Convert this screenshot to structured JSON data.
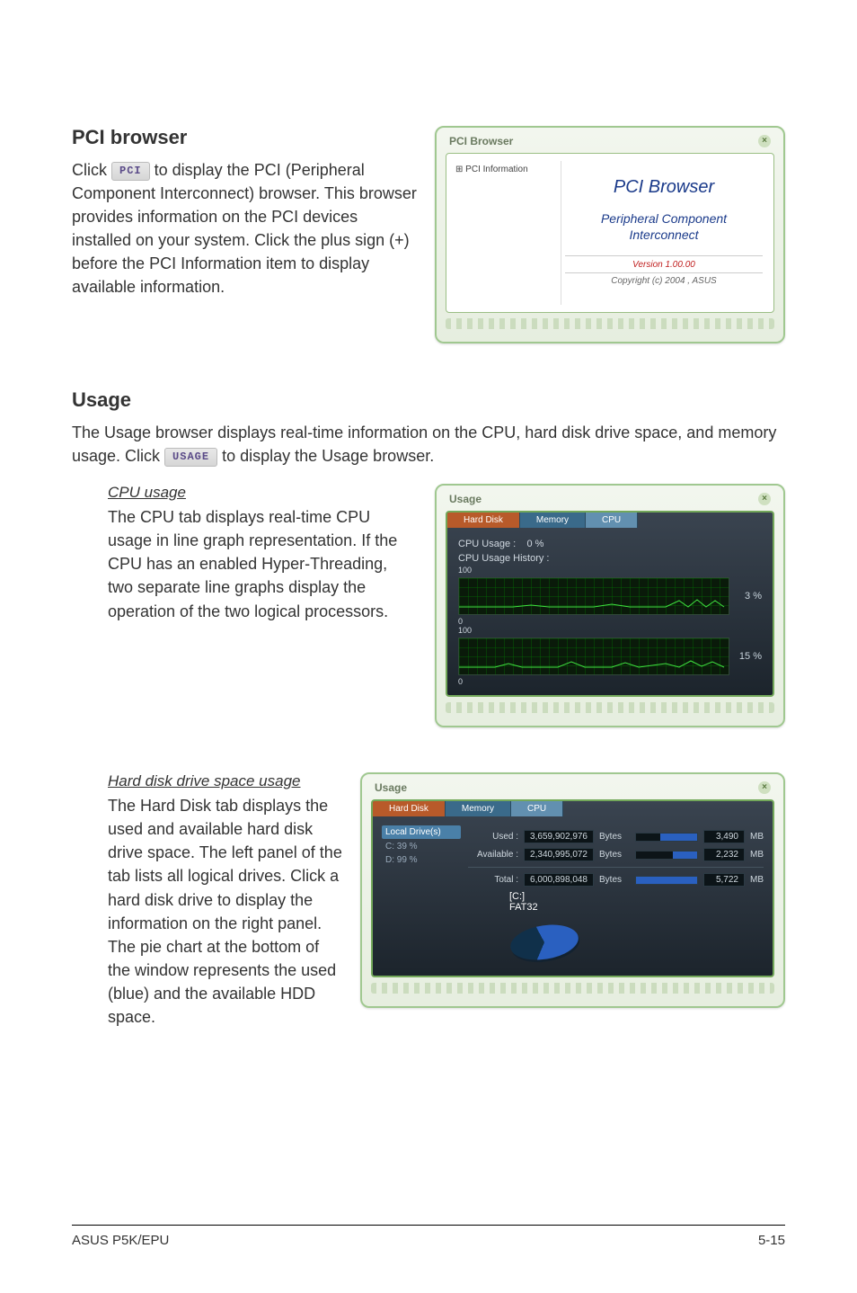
{
  "sections": {
    "pci": {
      "title": "PCI browser",
      "body_pre": "Click ",
      "btn": "PCI",
      "body_post": " to display the PCI (Peripheral Component Interconnect) browser. This browser provides information on the PCI devices installed on your system. Click the plus sign (+) before the PCI Information item to display available information."
    },
    "usage": {
      "title": "Usage",
      "intro_pre": "The Usage browser displays real-time information on the CPU, hard disk drive space, and memory usage. Click ",
      "btn": "USAGE",
      "intro_post": " to display the Usage browser.",
      "cpu": {
        "heading": "CPU usage",
        "body": "The CPU tab displays real-time CPU usage in line graph representation. If the CPU has an enabled Hyper-Threading, two separate line graphs display the operation of the two logical processors."
      },
      "hdd": {
        "heading": "Hard disk drive space usage",
        "body": "The Hard Disk tab displays the used and available hard disk drive space. The left panel of the tab lists all logical drives. Click a hard disk drive to display the information on the right panel. The pie chart at the bottom of the window represents the used (blue) and the available HDD space."
      }
    }
  },
  "pci_window": {
    "title": "PCI Browser",
    "tree_root": "PCI Information",
    "heading": "PCI Browser",
    "sub": "Peripheral Component Interconnect",
    "version": "Version 1.00.00",
    "copyright": "Copyright (c) 2004 , ASUS"
  },
  "cpu_window": {
    "title": "Usage",
    "tabs": [
      "Hard Disk",
      "Memory",
      "CPU"
    ],
    "cpu_usage_label": "CPU Usage :",
    "cpu_usage_value": "0  %",
    "history_label": "CPU Usage History :",
    "axis_top": "100",
    "axis_bot": "0",
    "pct1": "3 %",
    "pct2": "15 %"
  },
  "hdd_window": {
    "title": "Usage",
    "tabs": [
      "Hard Disk",
      "Memory",
      "CPU"
    ],
    "left_head": "Local Drive(s)",
    "drives": [
      "C:  39 %",
      "D:  99 %"
    ],
    "rows": {
      "used": {
        "label": "Used :",
        "bytes": "3,659,902,976",
        "unit": "Bytes",
        "mb": "3,490",
        "mbu": "MB",
        "fill": 60
      },
      "available": {
        "label": "Available :",
        "bytes": "2,340,995,072",
        "unit": "Bytes",
        "mb": "2,232",
        "mbu": "MB",
        "fill": 40
      },
      "total": {
        "label": "Total :",
        "bytes": "6,000,898,048",
        "unit": "Bytes",
        "mb": "5,722",
        "mbu": "MB",
        "fill": 100
      }
    },
    "drive_label1": "[C:]",
    "drive_label2": "FAT32"
  },
  "footer": {
    "left": "ASUS P5K/EPU",
    "right": "5-15"
  }
}
